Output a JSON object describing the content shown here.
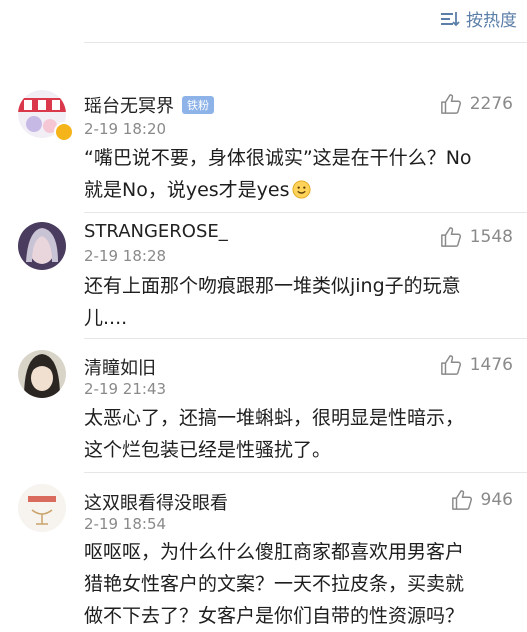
{
  "header": {
    "sort_label": "按热度"
  },
  "comments": [
    {
      "user": "瑶台无冥界",
      "badge": "铁粉",
      "time": "2-19 18:20",
      "likes": "2276",
      "text_lines": [
        "“嘴巴说不要，身体很诚实”这是在干什么？No",
        "就是No，说yes才是yes"
      ],
      "emoji": "smile-emoji"
    },
    {
      "user": "STRANGEROSE_",
      "time": "2-19 18:28",
      "likes": "1548",
      "text_lines": [
        "还有上面那个吻痕跟那一堆类似jing子的玩意",
        "儿...."
      ]
    },
    {
      "user": "清瞳如旧",
      "time": "2-19 21:43",
      "likes": "1476",
      "text_lines": [
        "太恶心了，还搞一堆蝌蚪，很明显是性暗示，",
        "这个烂包装已经是性骚扰了。"
      ]
    },
    {
      "user": "这双眼看得没眼看",
      "time": "2-19 18:54",
      "likes": "946",
      "text_lines": [
        "呕呕呕，为什么什么傻肛商家都喜欢用男客户",
        "猎艳女性客户的文案？一天不拉皮条，买卖就",
        "做不下去了？女客户是你们自带的性资源吗？"
      ]
    }
  ],
  "colors": {
    "link_blue": "#5b7fa8",
    "badge_blue": "#8eb3e8",
    "meta_gray": "#8a8a8a"
  },
  "icons": {
    "sort": "sort-lines-icon",
    "like": "thumb-up-icon",
    "emoji": "smile-emoji"
  }
}
